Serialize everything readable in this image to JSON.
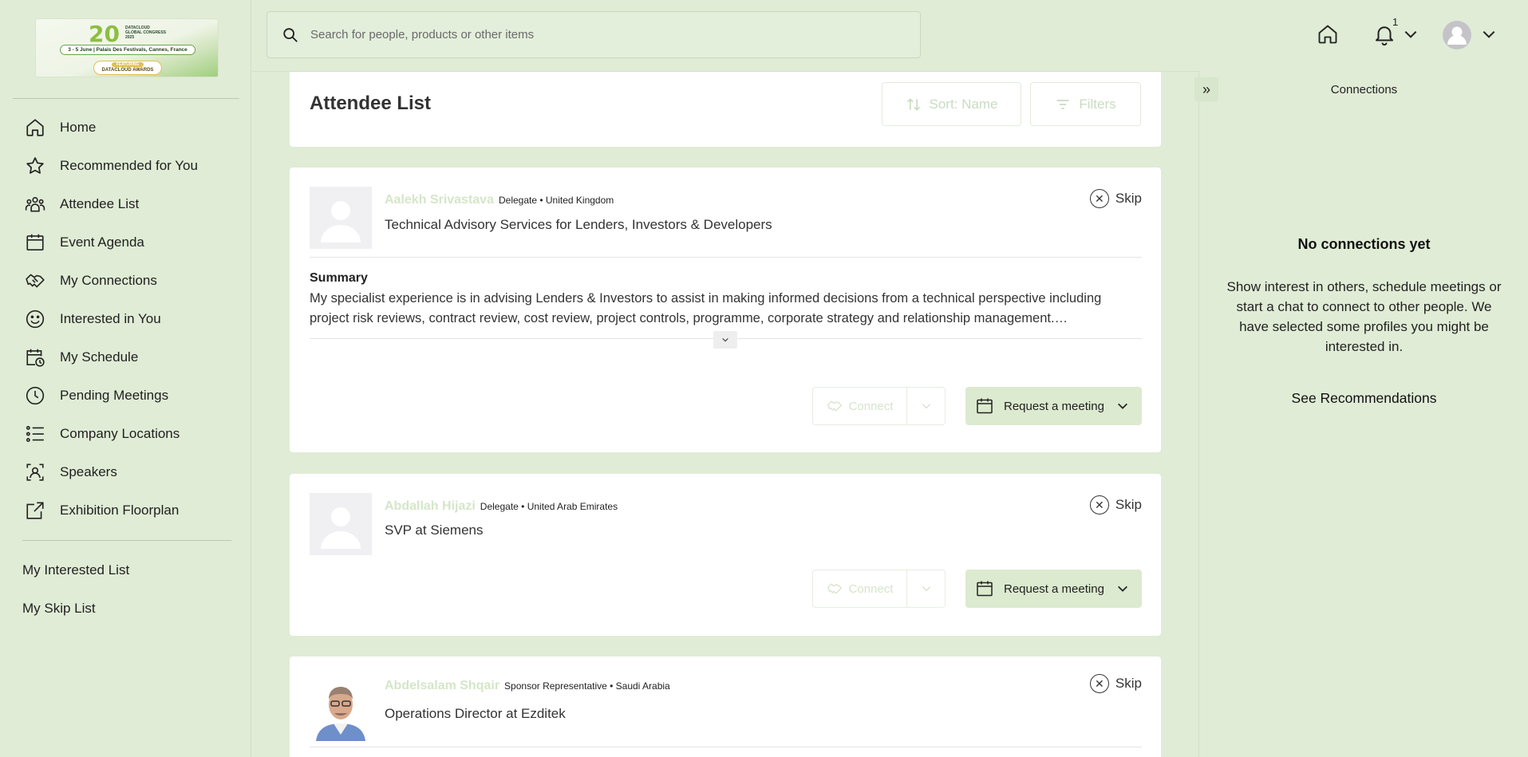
{
  "logo": {
    "number": "20",
    "brand_lines": [
      "DATACLOUD",
      "GLOBAL CONGRESS",
      "2025"
    ],
    "dates_venue": "3 - 5 June  |  Palais Des Festivals, Cannes, France",
    "awards_tag": "FEATURING",
    "awards_name": "DATACLOUD AWARDS"
  },
  "sidebar": {
    "items": [
      {
        "label": "Home",
        "icon": "home-icon"
      },
      {
        "label": "Recommended for You",
        "icon": "star-icon"
      },
      {
        "label": "Attendee List",
        "icon": "group-icon"
      },
      {
        "label": "Event Agenda",
        "icon": "calendar-icon"
      },
      {
        "label": "My Connections",
        "icon": "handshake-icon"
      },
      {
        "label": "Interested in You",
        "icon": "smiley-icon"
      },
      {
        "label": "My Schedule",
        "icon": "calendar-clock-icon"
      },
      {
        "label": "Pending Meetings",
        "icon": "clock-icon"
      },
      {
        "label": "Company Locations",
        "icon": "list-icon"
      },
      {
        "label": "Speakers",
        "icon": "speaker-icon"
      },
      {
        "label": "Exhibition Floorplan",
        "icon": "external-link-icon"
      }
    ],
    "sub_items": [
      "My Interested List",
      "My Skip List"
    ]
  },
  "search": {
    "placeholder": "Search for people, products or other items"
  },
  "topbar": {
    "notification_count": "1"
  },
  "main": {
    "title": "Attendee List",
    "sort_label": "Sort: Name",
    "filters_label": "Filters",
    "skip_label": "Skip",
    "connect_label": "Connect",
    "meeting_label": "Request a meeting",
    "attendees": [
      {
        "name": "Aalekh Srivastava",
        "meta": "Delegate • United Kingdom",
        "job": "Technical Advisory Services for Lenders, Investors & Developers",
        "summary_label": "Summary",
        "summary": "My specialist experience is in advising Lenders & Investors to assist in making informed decisions from a technical perspective including project risk reviews, contract review, cost review, project controls, programme, corporate strategy and relationship management.…"
      },
      {
        "name": "Abdallah Hijazi",
        "meta": "Delegate • United Arab Emirates",
        "job": "SVP at Siemens"
      },
      {
        "name": "Abdelsalam Shqair",
        "meta": "Sponsor Representative • Saudi Arabia",
        "job": "Operations Director at Ezditek"
      }
    ]
  },
  "right_panel": {
    "title": "Connections",
    "empty_title": "No connections yet",
    "empty_text": "Show interest in others, schedule meetings or start a chat to connect to other people. We have selected some profiles you might be interested in.",
    "cta": "See Recommendations"
  },
  "colors": {
    "background": "#e0ecd6",
    "accent_button": "#dceacf",
    "muted_name": "#d4e6c8"
  }
}
